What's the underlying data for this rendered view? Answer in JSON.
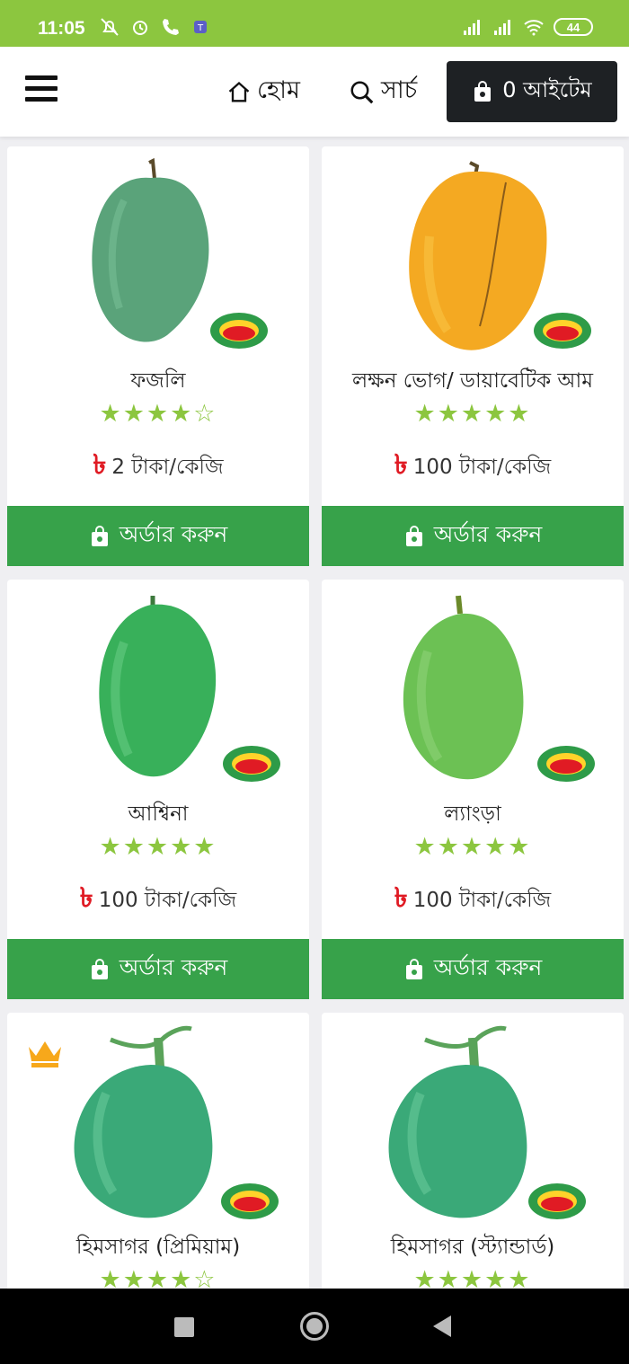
{
  "status": {
    "time": "11:05",
    "battery": "44"
  },
  "header": {
    "home_label": "হোম",
    "search_label": "সার্চ",
    "cart_label": "0 আইটেম"
  },
  "products": [
    {
      "name": "ফজলি",
      "rating": 4,
      "stars": "★★★★☆",
      "price": "2 টাকা/কেজি",
      "currency": "৳",
      "order_label": "অর্ডার করুন",
      "mango_color": "green-dark"
    },
    {
      "name": "লক্ষন ভোগ/ ডায়াবেটিক আম",
      "rating": 5,
      "stars": "★★★★★",
      "price": "100 টাকা/কেজি",
      "currency": "৳",
      "order_label": "অর্ডার করুন",
      "mango_color": "yellow"
    },
    {
      "name": "আশ্বিনা",
      "rating": 5,
      "stars": "★★★★★",
      "price": "100 টাকা/কেজি",
      "currency": "৳",
      "order_label": "অর্ডার করুন",
      "mango_color": "green"
    },
    {
      "name": "ল্যাংড়া",
      "rating": 5,
      "stars": "★★★★★",
      "price": "100 টাকা/কেজি",
      "currency": "৳",
      "order_label": "অর্ডার করুন",
      "mango_color": "green-light"
    },
    {
      "name": "হিমসাগর (প্রিমিয়াম)",
      "rating": 4,
      "stars": "★★★★☆",
      "price": "",
      "currency": "",
      "order_label": "",
      "mango_color": "green",
      "premium": true
    },
    {
      "name": "হিমসাগর (স্ট্যান্ডার্ড)",
      "rating": 5,
      "stars": "★★★★★",
      "price": "",
      "currency": "",
      "order_label": "",
      "mango_color": "green"
    }
  ],
  "colors": {
    "status_bar": "#8cc63f",
    "order_button": "#37a24a",
    "stars": "#8cc63f",
    "cart_button": "#1e2124",
    "taka": "#e01b24"
  }
}
